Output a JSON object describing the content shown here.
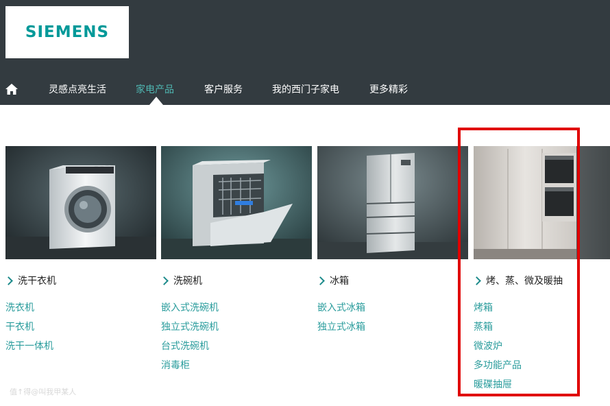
{
  "brand": {
    "logo_text": "SIEMENS"
  },
  "nav": {
    "items": [
      {
        "label": "灵感点亮生活"
      },
      {
        "label": "家电产品"
      },
      {
        "label": "客户服务"
      },
      {
        "label": "我的西门子家电"
      },
      {
        "label": "更多精彩"
      }
    ]
  },
  "categories": [
    {
      "title": "洗干衣机",
      "links": [
        "洗衣机",
        "干衣机",
        "洗干一体机"
      ]
    },
    {
      "title": "洗碗机",
      "links": [
        "嵌入式洗碗机",
        "独立式洗碗机",
        "台式洗碗机",
        "消毒柜"
      ]
    },
    {
      "title": "冰箱",
      "links": [
        "嵌入式冰箱",
        "独立式冰箱"
      ]
    },
    {
      "title": "烤、蒸、微及暖抽",
      "links": [
        "烤箱",
        "蒸箱",
        "微波炉",
        "多功能产品",
        "暖碟抽屉"
      ]
    }
  ],
  "watermark": "值↑得@叫我甲某人",
  "colors": {
    "header_bg": "#333b40",
    "accent": "#009999",
    "link": "#2a9c9c",
    "highlight": "#e00000"
  }
}
